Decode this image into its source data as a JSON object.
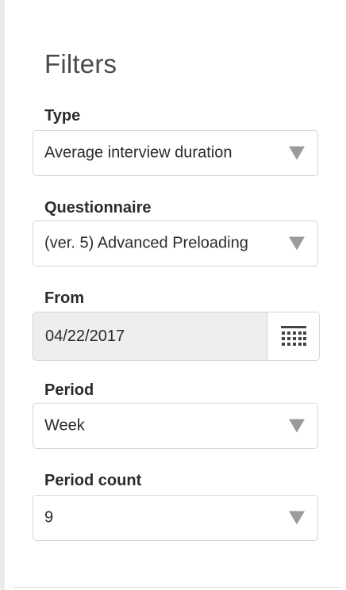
{
  "filters": {
    "title": "Filters",
    "type": {
      "label": "Type",
      "value": "Average interview duration"
    },
    "questionnaire": {
      "label": "Questionnaire",
      "value": "(ver. 5) Advanced Preloading"
    },
    "from": {
      "label": "From",
      "value": "04/22/2017"
    },
    "period": {
      "label": "Period",
      "value": "Week"
    },
    "period_count": {
      "label": "Period count",
      "value": "9"
    }
  },
  "icons": {
    "dropdown": "caret-down-icon",
    "calendar": "calendar-icon"
  },
  "colors": {
    "panel_background": "#ffffff",
    "sidebar_strip": "#e9eaea",
    "disabled_input": "#eeeeee",
    "border": "#d4d4d4",
    "caret": "#9b9b9b",
    "text": "#2b2b2b"
  }
}
